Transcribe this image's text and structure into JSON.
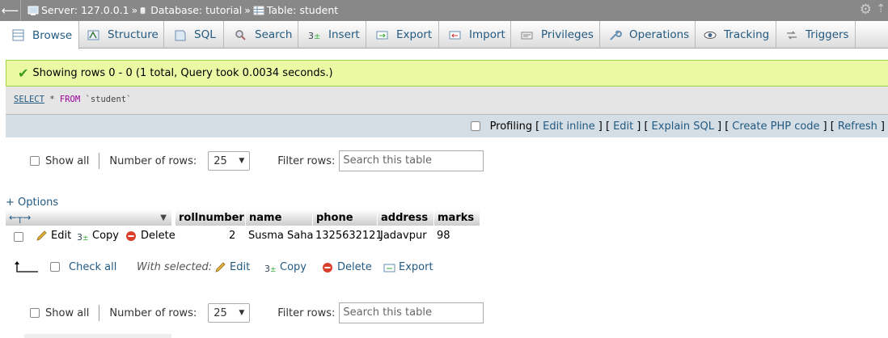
{
  "breadcrumb": {
    "server": "Server: 127.0.0.1",
    "database": "Database: tutorial",
    "table": "Table: student",
    "separator": "»"
  },
  "tabs": [
    {
      "label": "Browse",
      "icon": "browse-icon",
      "active": true
    },
    {
      "label": "Structure",
      "icon": "structure-icon"
    },
    {
      "label": "SQL",
      "icon": "sql-icon"
    },
    {
      "label": "Search",
      "icon": "search-icon"
    },
    {
      "label": "Insert",
      "icon": "insert-icon"
    },
    {
      "label": "Export",
      "icon": "export-icon"
    },
    {
      "label": "Import",
      "icon": "import-icon"
    },
    {
      "label": "Privileges",
      "icon": "privileges-icon"
    },
    {
      "label": "Operations",
      "icon": "operations-icon"
    },
    {
      "label": "Tracking",
      "icon": "tracking-icon"
    },
    {
      "label": "Triggers",
      "icon": "triggers-icon"
    }
  ],
  "message": "Showing rows 0 - 0 (1 total, Query took 0.0034 seconds.)",
  "sql": {
    "select": "SELECT",
    "star": " * ",
    "from": "FROM",
    "table": " `student`"
  },
  "profiling": {
    "label": "Profiling",
    "edit_inline": "Edit inline",
    "edit": "Edit",
    "explain": "Explain SQL",
    "php": "Create PHP code",
    "refresh": "Refresh",
    "open": "[",
    "close": "]",
    "mid": "] ["
  },
  "nav": {
    "show_all": "Show all",
    "rows_label": "Number of rows:",
    "rows_value": "25",
    "filter_label": "Filter rows:",
    "filter_placeholder": "Search this table"
  },
  "options_link": "+ Options",
  "columns": [
    "rollnumber",
    "name",
    "phone",
    "address",
    "marks"
  ],
  "row_actions": {
    "edit": "Edit",
    "copy": "Copy",
    "delete": "Delete"
  },
  "rows": [
    {
      "rollnumber": "2",
      "name": "Susma Saha",
      "phone": "1325632121",
      "address": "Jadavpur",
      "marks": "98"
    }
  ],
  "bulk": {
    "check_all": "Check all",
    "with_selected": "With selected:",
    "edit": "Edit",
    "copy": "Copy",
    "delete": "Delete",
    "export": "Export"
  },
  "colors": {
    "accent": "#235a81",
    "success_bg": "#ebf8a4",
    "topbar": "#888888"
  }
}
